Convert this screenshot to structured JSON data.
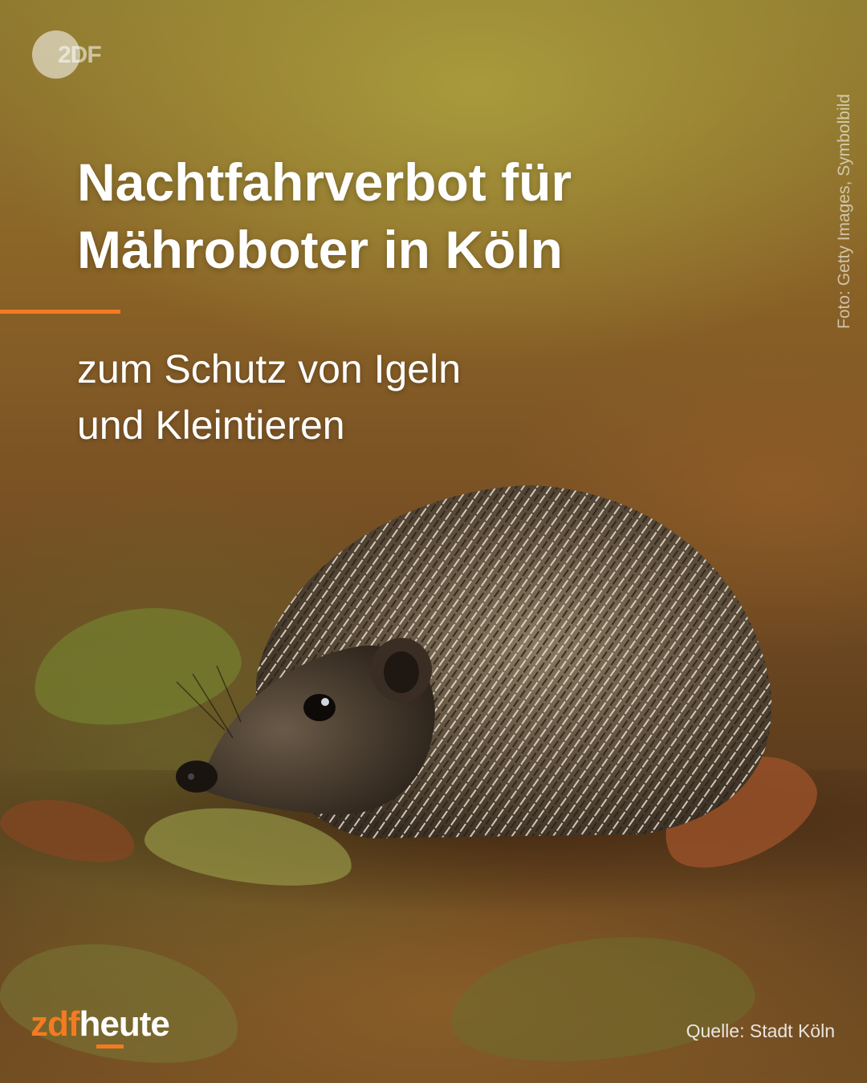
{
  "top_logo": {
    "text": "2DF"
  },
  "headline": {
    "line1": "Nachtfahrverbot für",
    "line2": "Mähroboter in Köln"
  },
  "subline": {
    "line1": "zum Schutz von Igeln",
    "line2": "und Kleintieren"
  },
  "photo_credit": "Foto: Getty Images, Symbolbild",
  "brand": {
    "part1": "zdf",
    "part2": "heute"
  },
  "source": "Quelle: Stadt Köln",
  "colors": {
    "accent": "#f47b20",
    "text": "#ffffff",
    "background": "#7a5224"
  }
}
